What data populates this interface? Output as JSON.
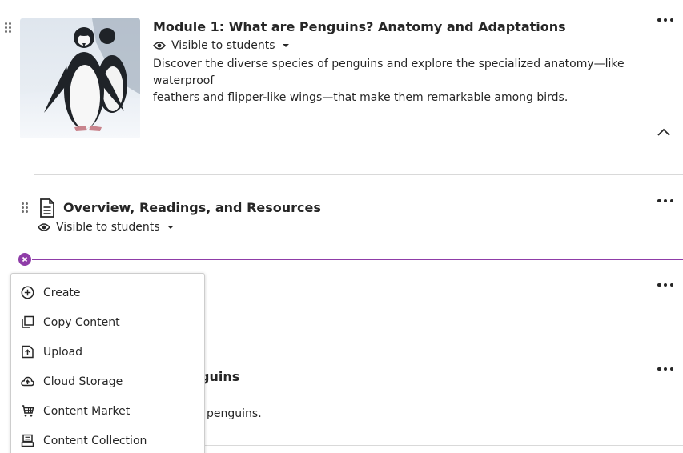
{
  "module": {
    "title": "Module 1: What are Penguins? Anatomy and Adaptations",
    "visibility": "Visible to students",
    "description_line1": "Discover the diverse species of penguins and explore the specialized anatomy—like waterproof",
    "description_line2": "feathers and flipper-like wings—that make them remarkable among birds.",
    "thumbnail_icon": "penguin-photo"
  },
  "items": [
    {
      "title": "Overview, Readings, and Resources",
      "visibility": "Visible to students",
      "icon": "document-icon"
    }
  ],
  "partially_hidden": {
    "title_fragment": "guins",
    "desc_fragment": "penguins."
  },
  "add_menu": {
    "items": [
      {
        "label": "Create",
        "icon": "plus-circle-icon"
      },
      {
        "label": "Copy Content",
        "icon": "copy-icon"
      },
      {
        "label": "Upload",
        "icon": "upload-icon"
      },
      {
        "label": "Cloud Storage",
        "icon": "cloud-upload-icon"
      },
      {
        "label": "Content Market",
        "icon": "cart-icon"
      },
      {
        "label": "Content Collection",
        "icon": "collection-icon"
      }
    ]
  },
  "colors": {
    "accent": "#8f3da8",
    "text": "#262626",
    "divider": "#d9d9d9"
  }
}
